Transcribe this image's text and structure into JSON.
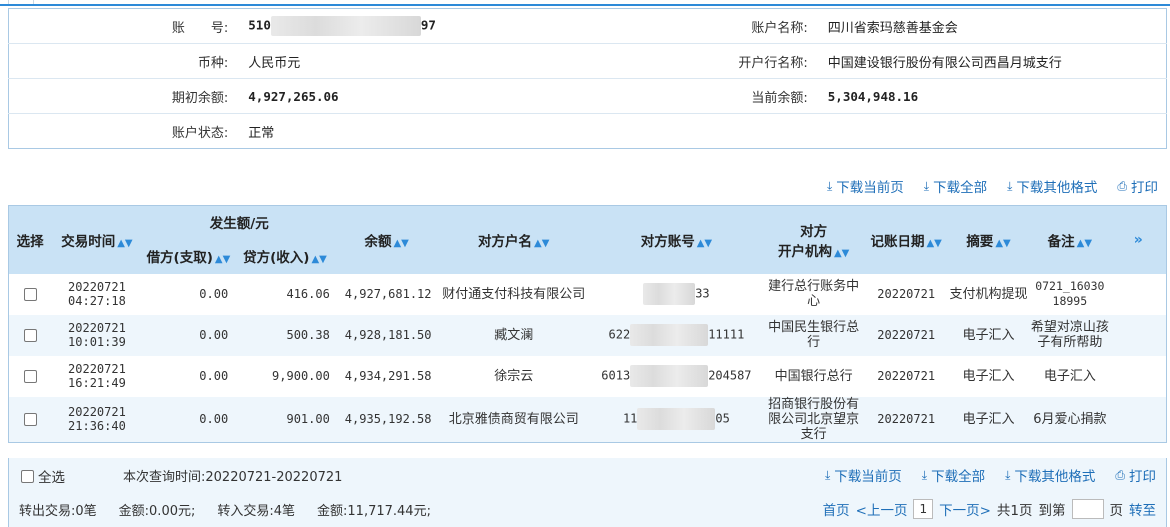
{
  "account": {
    "account_no_label": "账　　号:",
    "account_no_prefix": "510",
    "account_no_suffix": "97",
    "account_name_label": "账户名称:",
    "account_name": "四川省索玛慈善基金会",
    "currency_label": "币种:",
    "currency": "人民币元",
    "bank_name_label": "开户行名称:",
    "bank_name": "中国建设银行股份有限公司西昌月城支行",
    "opening_balance_label": "期初余额:",
    "opening_balance": "4,927,265.06",
    "current_balance_label": "当前余额:",
    "current_balance": "5,304,948.16",
    "status_label": "账户状态:",
    "status": "正常"
  },
  "actions": {
    "download_page": "下载当前页",
    "download_all": "下载全部",
    "download_other": "下载其他格式",
    "print": "打印"
  },
  "grid": {
    "headers": {
      "select": "选择",
      "time": "交易时间",
      "amount_group": "发生额/元",
      "debit": "借方(支取)",
      "credit": "贷方(收入)",
      "balance": "余额",
      "counterparty_name": "对方户名",
      "counterparty_account": "对方账号",
      "counterparty_bank_line1": "对方",
      "counterparty_bank_line2": "开户机构",
      "post_date": "记账日期",
      "summary": "摘要",
      "remark": "备注",
      "more": "»"
    },
    "rows": [
      {
        "date": "20220721",
        "time": "04:27:18",
        "debit": "0.00",
        "credit": "416.06",
        "balance": "4,927,681.12",
        "name": "财付通支付科技有限公司",
        "acct_prefix": "",
        "acct_suffix": "33",
        "bank": "建行总行账务中心",
        "post_date": "20220721",
        "summary": "支付机构提现",
        "remark": "0721_16030 18995"
      },
      {
        "date": "20220721",
        "time": "10:01:39",
        "debit": "0.00",
        "credit": "500.38",
        "balance": "4,928,181.50",
        "name": "臧文澜",
        "acct_prefix": "622",
        "acct_suffix": "11111",
        "bank": "中国民生银行总行",
        "post_date": "20220721",
        "summary": "电子汇入",
        "remark": "希望对凉山孩子有所帮助"
      },
      {
        "date": "20220721",
        "time": "16:21:49",
        "debit": "0.00",
        "credit": "9,900.00",
        "balance": "4,934,291.58",
        "name": "徐宗云",
        "acct_prefix": "6013",
        "acct_suffix": "204587",
        "bank": "中国银行总行",
        "post_date": "20220721",
        "summary": "电子汇入",
        "remark": "电子汇入"
      },
      {
        "date": "20220721",
        "time": "21:36:40",
        "debit": "0.00",
        "credit": "901.00",
        "balance": "4,935,192.58",
        "name": "北京雅债商贸有限公司",
        "acct_prefix": "11",
        "acct_suffix": "05",
        "bank": "招商银行股份有限公司北京望京支行",
        "post_date": "20220721",
        "summary": "电子汇入",
        "remark": "6月爱心捐款"
      }
    ]
  },
  "footer": {
    "select_all": "全选",
    "query_range": "本次查询时间:20220721-20220721",
    "out_count": "转出交易:0笔",
    "out_amount": "金额:0.00元;",
    "in_count": "转入交易:4笔",
    "in_amount": "金额:11,717.44元;",
    "first": "首页",
    "prev": "<上一页",
    "page": "1",
    "next": "下一页>",
    "total": "共1页",
    "goto_label": "到第",
    "page_unit": "页",
    "go": "转至"
  },
  "colors": {
    "header_bg": "#c9e2f5",
    "link": "#1f6fb8",
    "border": "#a9c9e4",
    "stripe": "#eef6fc"
  }
}
